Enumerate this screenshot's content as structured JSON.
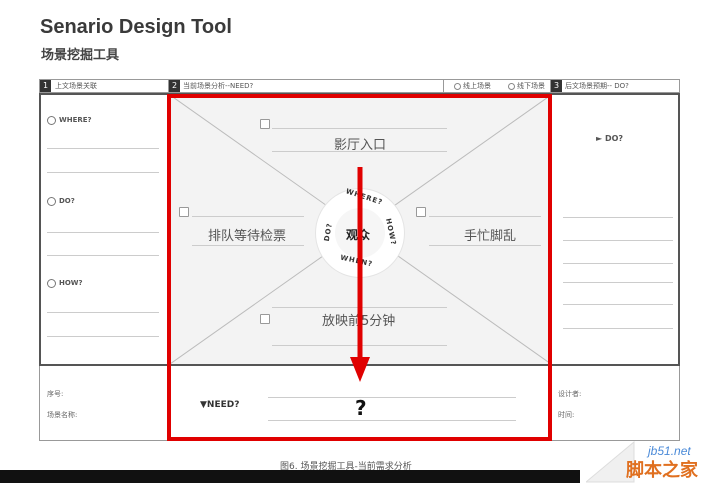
{
  "header": {
    "title": "Senario Design Tool",
    "subtitle": "场景挖掘工具"
  },
  "columns": {
    "col1": {
      "num": "1",
      "label": "上文场景关联"
    },
    "col2": {
      "num": "2",
      "label": "当前场景分析--NEED?",
      "option_online": "线上场景",
      "option_offline": "线下场景"
    },
    "col3": {
      "num": "3",
      "label": "后文场景预期-- DO?"
    }
  },
  "left_panel": {
    "where": "WHERE?",
    "do": "DO?",
    "how": "HOW?"
  },
  "center": {
    "top": "影厅入口",
    "left": "排队等待检票",
    "right": "手忙脚乱",
    "bottom": "放映前5分钟",
    "core": "观众",
    "ring_where": "WHERE?",
    "ring_how": "HOW?",
    "ring_when": "WHEN?",
    "ring_do": "DO?"
  },
  "right_panel": {
    "do": "► DO?"
  },
  "footer": {
    "serial": "序号:",
    "scene_name": "场景名称:",
    "need": "▼NEED?",
    "question": "?",
    "designer": "设计者:",
    "time": "时间:"
  },
  "caption": "图6. 场景挖掘工具-当前需求分析",
  "watermark": {
    "site": "jb51.net",
    "brand": "脚本之家"
  },
  "colors": {
    "highlight": "#e00000",
    "panel": "#f3f3f3",
    "border": "#555555"
  }
}
